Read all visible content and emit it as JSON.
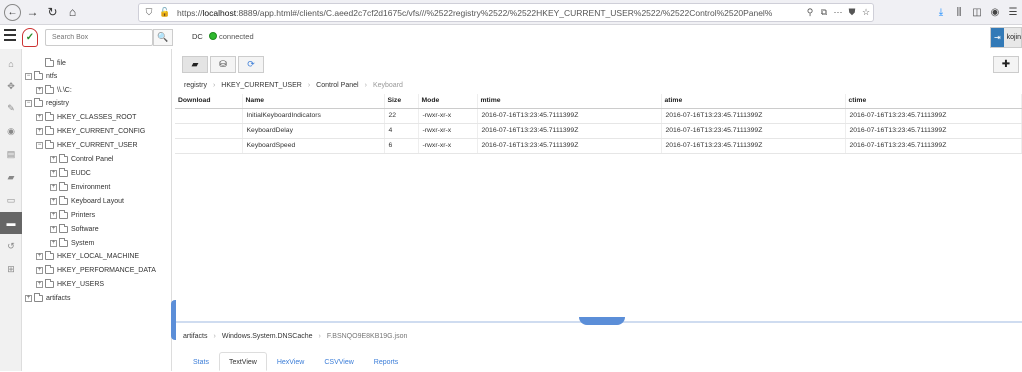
{
  "browser": {
    "url_host": "localhost",
    "url_prefix": "https://",
    "url_rest": ":8889/app.html#/clients/C.aeed2c7cf2d1675c/vfs///%2522registry%2522/%2522HKEY_CURRENT_USER%2522/%2522Control%2520Panel%"
  },
  "header": {
    "search_placeholder": "Search Box",
    "client_label": "DC",
    "status": "connected",
    "user": "kojin"
  },
  "tree": {
    "items": [
      {
        "label": "file",
        "depth": 1,
        "pm": ""
      },
      {
        "label": "ntfs",
        "depth": 0,
        "pm": "−"
      },
      {
        "label": "\\\\.\\C:",
        "depth": 1,
        "pm": "+"
      },
      {
        "label": "registry",
        "depth": 0,
        "pm": "−"
      },
      {
        "label": "HKEY_CLASSES_ROOT",
        "depth": 1,
        "pm": "+"
      },
      {
        "label": "HKEY_CURRENT_CONFIG",
        "depth": 1,
        "pm": "+"
      },
      {
        "label": "HKEY_CURRENT_USER",
        "depth": 1,
        "pm": "−"
      },
      {
        "label": "Control Panel",
        "depth": 2,
        "pm": "+"
      },
      {
        "label": "EUDC",
        "depth": 2,
        "pm": "+"
      },
      {
        "label": "Environment",
        "depth": 2,
        "pm": "+"
      },
      {
        "label": "Keyboard Layout",
        "depth": 2,
        "pm": "+"
      },
      {
        "label": "Printers",
        "depth": 2,
        "pm": "+"
      },
      {
        "label": "Software",
        "depth": 2,
        "pm": "+"
      },
      {
        "label": "System",
        "depth": 2,
        "pm": "+"
      },
      {
        "label": "HKEY_LOCAL_MACHINE",
        "depth": 1,
        "pm": "+"
      },
      {
        "label": "HKEY_PERFORMANCE_DATA",
        "depth": 1,
        "pm": "+"
      },
      {
        "label": "HKEY_USERS",
        "depth": 1,
        "pm": "+"
      },
      {
        "label": "artifacts",
        "depth": 0,
        "pm": "+"
      }
    ]
  },
  "breadcrumb": [
    "registry",
    "HKEY_CURRENT_USER",
    "Control Panel",
    "Keyboard"
  ],
  "table": {
    "headers": [
      "Download",
      "Name",
      "Size",
      "Mode",
      "mtime",
      "atime",
      "ctime"
    ],
    "rows": [
      [
        "",
        "InitialKeyboardIndicators",
        "22",
        "-rwxr-xr-x",
        "2016-07-16T13:23:45.7111399Z",
        "2016-07-16T13:23:45.7111399Z",
        "2016-07-16T13:23:45.7111399Z"
      ],
      [
        "",
        "KeyboardDelay",
        "4",
        "-rwxr-xr-x",
        "2016-07-16T13:23:45.7111399Z",
        "2016-07-16T13:23:45.7111399Z",
        "2016-07-16T13:23:45.7111399Z"
      ],
      [
        "",
        "KeyboardSpeed",
        "6",
        "-rwxr-xr-x",
        "2016-07-16T13:23:45.7111399Z",
        "2016-07-16T13:23:45.7111399Z",
        "2016-07-16T13:23:45.7111399Z"
      ]
    ]
  },
  "bottom": {
    "breadcrumb": [
      "artifacts",
      "Windows.System.DNSCache",
      "F.BSNQO9E8KB19G.json"
    ],
    "tabs": [
      "Stats",
      "TextView",
      "HexView",
      "CSVView",
      "Reports"
    ],
    "active_tab": "TextView"
  },
  "colors": {
    "accent": "#3b7dd8",
    "status": "#2eb82e",
    "handle": "#5b8ed8"
  },
  "icons": {
    "sidenav": [
      "home-icon",
      "crosshair-icon",
      "wrench-icon",
      "eye-icon",
      "list-icon",
      "book-icon",
      "laptop-icon",
      "folder-open-icon",
      "history-icon",
      "binoculars-icon"
    ]
  }
}
